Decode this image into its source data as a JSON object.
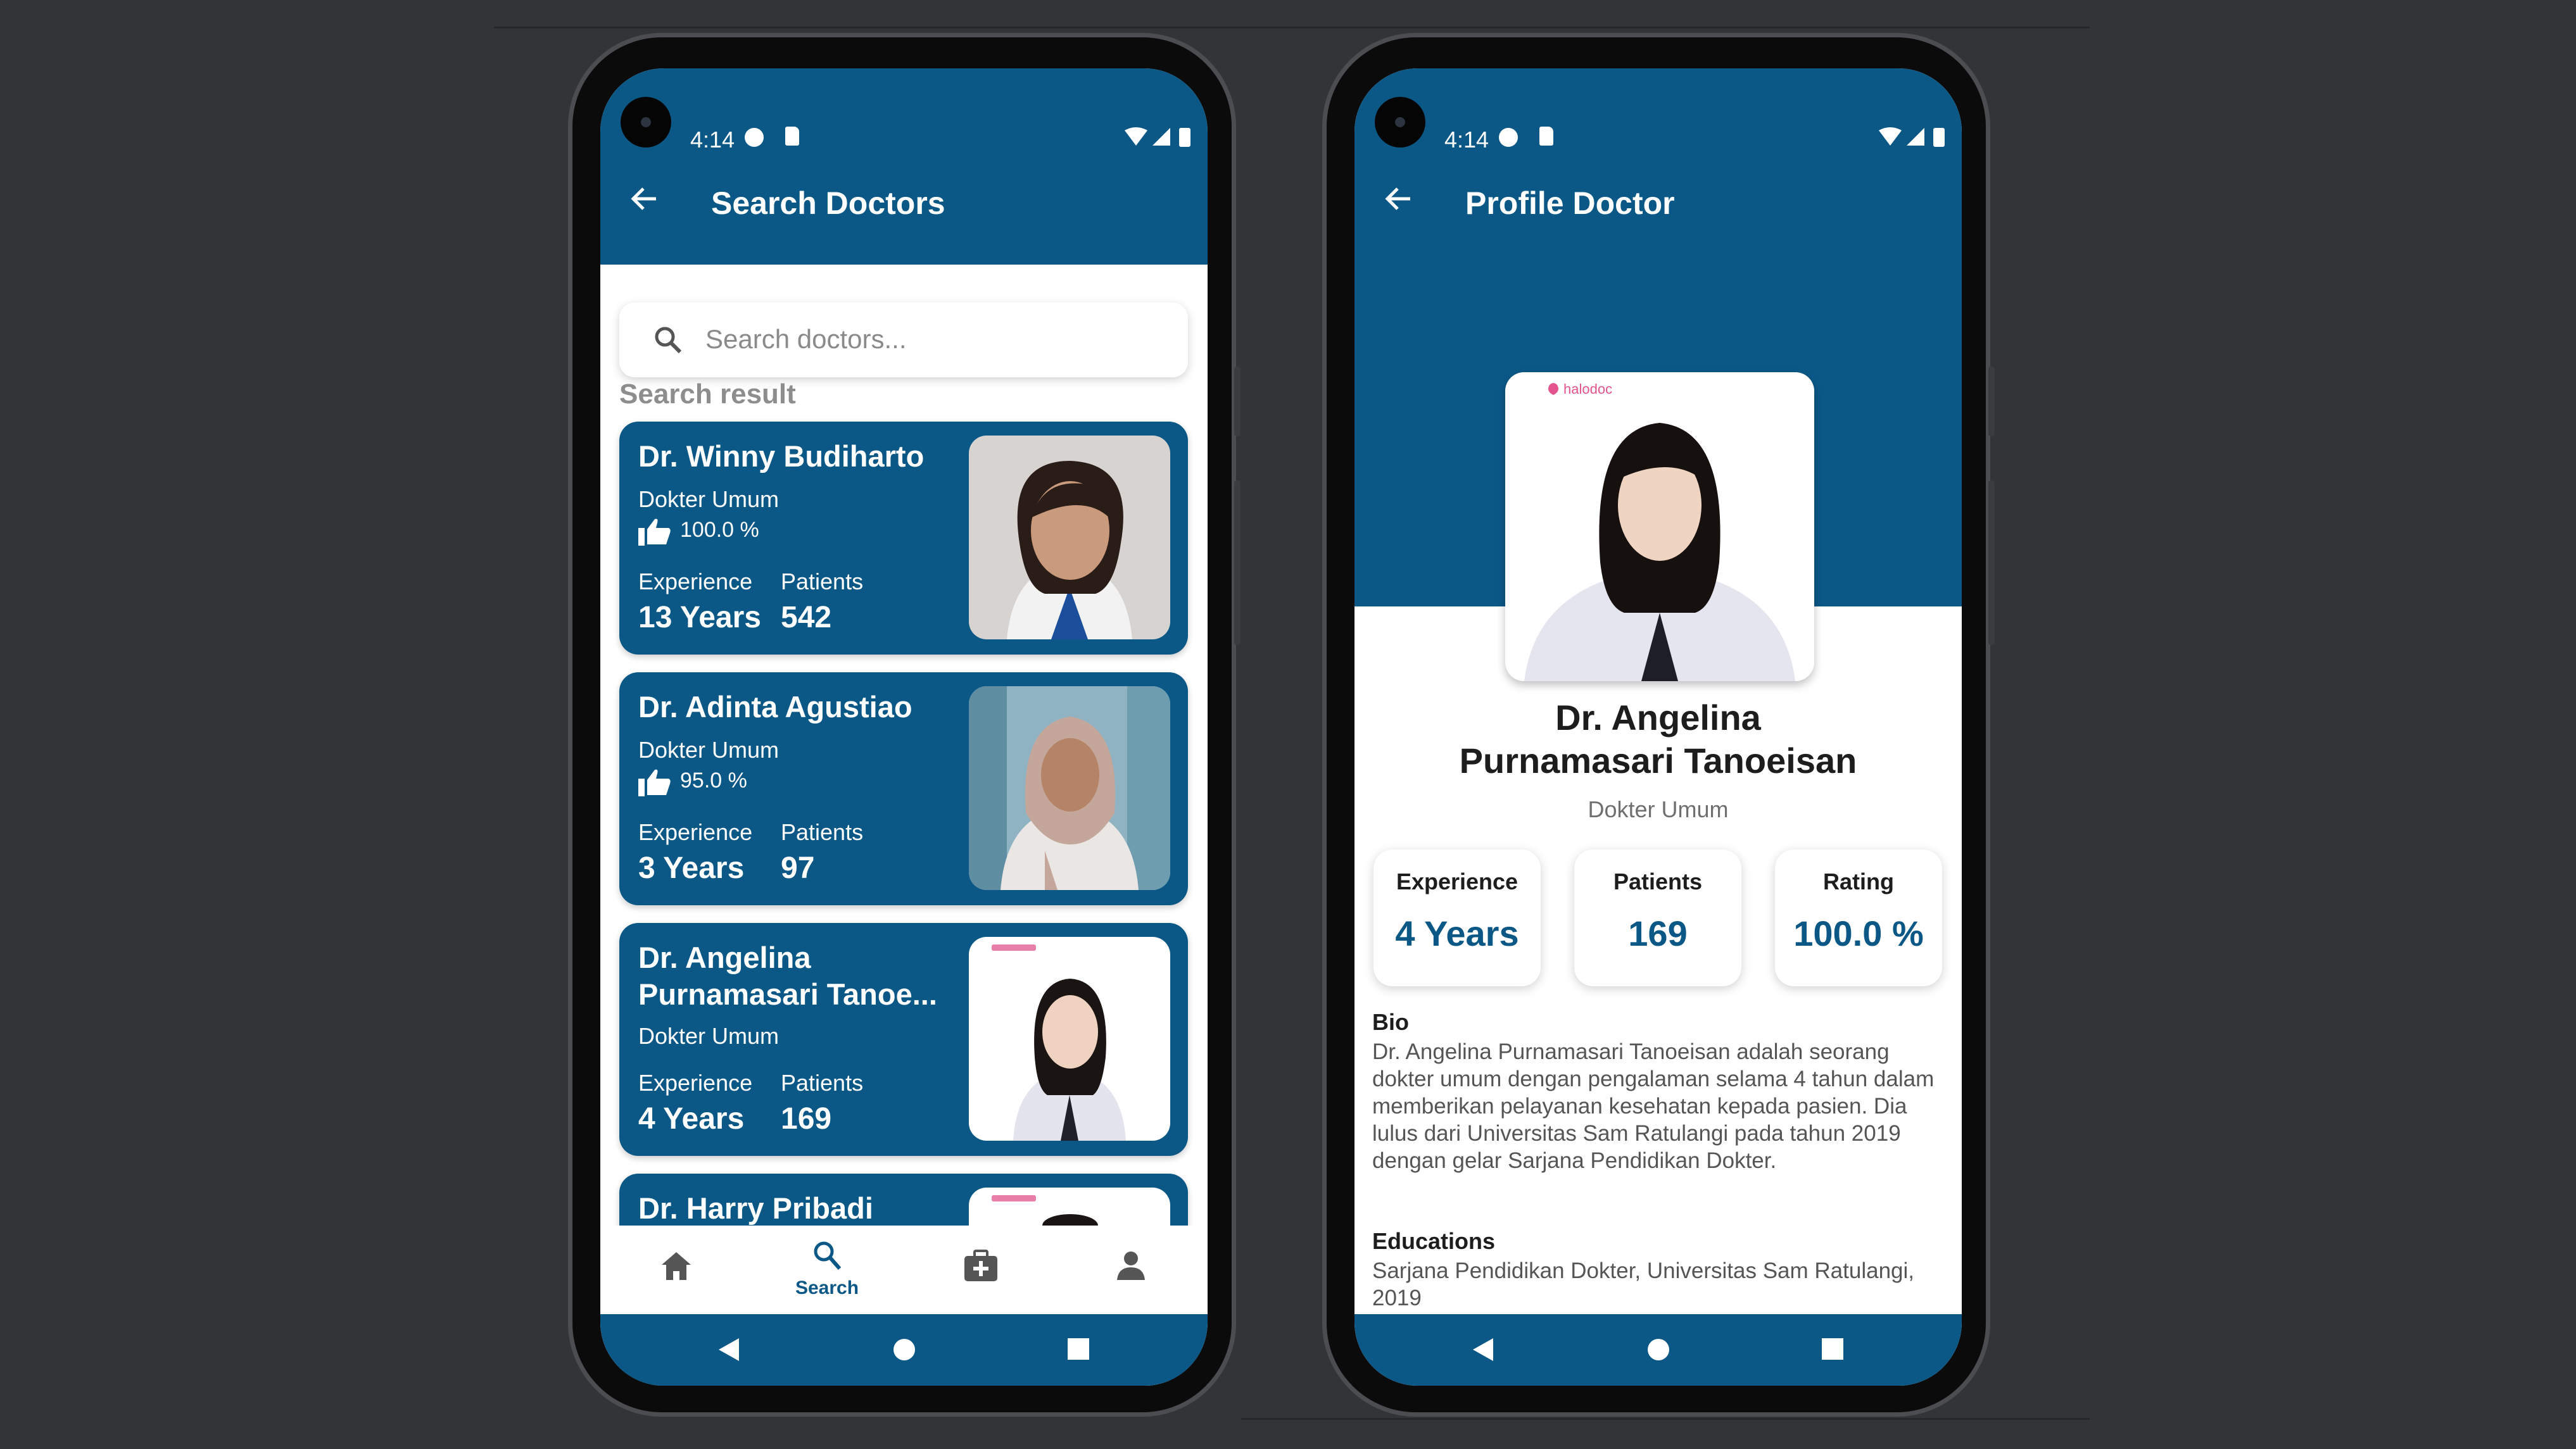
{
  "colors": {
    "primary": "#0b5887",
    "background": "#333435"
  },
  "status_bar": {
    "time": "4:14"
  },
  "search_screen": {
    "title": "Search Doctors",
    "search_placeholder": "Search doctors...",
    "section_label": "Search result",
    "doctors": [
      {
        "name": "Dr. Winny Budiharto",
        "specialty": "Dokter Umum",
        "rating": "100.0 %",
        "experience_label": "Experience",
        "experience": "13 Years",
        "patients_label": "Patients",
        "patients": "542"
      },
      {
        "name": "Dr. Adinta Agustiao",
        "specialty": "Dokter Umum",
        "rating": "95.0 %",
        "experience_label": "Experience",
        "experience": "3 Years",
        "patients_label": "Patients",
        "patients": "97"
      },
      {
        "name": "Dr. Angelina Purnamasari Tanoe...",
        "specialty": "Dokter Umum",
        "experience_label": "Experience",
        "experience": "4 Years",
        "patients_label": "Patients",
        "patients": "169"
      },
      {
        "name": "Dr. Harry Pribadi"
      }
    ],
    "bottom_nav": {
      "active_label": "Search",
      "icons": [
        "home-icon",
        "search-icon",
        "medical-kit-icon",
        "person-icon"
      ]
    }
  },
  "profile_screen": {
    "title": "Profile Doctor",
    "photo_logo": "halodoc",
    "name": "Dr. Angelina Purnamasari Tanoeisan",
    "specialty": "Dokter Umum",
    "stats": [
      {
        "label": "Experience",
        "value": "4 Years"
      },
      {
        "label": "Patients",
        "value": "169"
      },
      {
        "label": "Rating",
        "value": "100.0 %"
      }
    ],
    "bio_title": "Bio",
    "bio": "Dr. Angelina Purnamasari Tanoeisan adalah seorang dokter umum dengan pengalaman selama 4 tahun dalam memberikan pelayanan kesehatan kepada pasien. Dia lulus dari Universitas Sam Ratulangi pada tahun 2019 dengan gelar Sarjana Pendidikan Dokter.",
    "educations_title": "Educations",
    "educations": "Sarjana Pendidikan Dokter, Universitas Sam Ratulangi, 2019"
  }
}
